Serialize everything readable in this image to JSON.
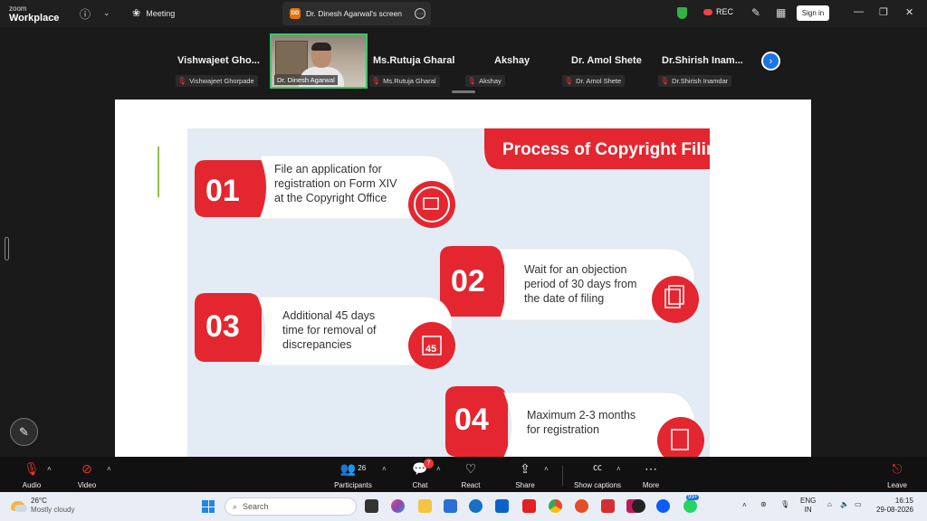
{
  "titlebar": {
    "brand_line1": "zoom",
    "brand_line2": "Workplace",
    "info_icon": "info-icon",
    "meeting_label": "Meeting",
    "screen_tab_badge": "DD",
    "screen_tab_title": "Dr. Dinesh Agarwal's screen",
    "rec_label": "REC",
    "signin_label": "Sign in"
  },
  "participants": [
    {
      "name": "Vishwajeet  Gho...",
      "label": "Vishwajeet Ghorpade"
    },
    {
      "name": "",
      "label": "Dr. Dinesh Agarwal"
    },
    {
      "name": "Ms.Rutuja Gharal",
      "label": "Ms.Rutuja Gharal"
    },
    {
      "name": "Akshay",
      "label": "Akshay"
    },
    {
      "name": "Dr. Amol Shete",
      "label": "Dr. Amol Shete"
    },
    {
      "name": "Dr.Shirish  Inam...",
      "label": "Dr.Shirish Inamdar"
    }
  ],
  "slide": {
    "banner": "Process of Copyright Filing",
    "steps": [
      {
        "num": "01",
        "lines": [
          "File an application for",
          "registration on Form XIV",
          "at the Copyright Office"
        ]
      },
      {
        "num": "02",
        "lines": [
          "Wait for an objection",
          "period of 30 days from",
          "the date of filing"
        ]
      },
      {
        "num": "03",
        "lines": [
          "Additional 45 days",
          "time for removal of",
          "discrepancies"
        ]
      },
      {
        "num": "04",
        "lines": [
          "Maximum 2-3 months",
          "for registration"
        ]
      }
    ],
    "calendar_number": "45"
  },
  "toolbar": {
    "audio": "Audio",
    "video": "Video",
    "participants": "Participants",
    "participants_count": "26",
    "chat": "Chat",
    "chat_badge": "7",
    "react": "React",
    "share": "Share",
    "captions": "Show captions",
    "more": "More",
    "leave": "Leave"
  },
  "taskbar": {
    "temperature": "26°C",
    "weather": "Mostly cloudy",
    "search_placeholder": "Search",
    "lang_line1": "ENG",
    "lang_line2": "IN",
    "time": "16:15",
    "date": "29-08-2026",
    "badge_99": "99+"
  },
  "colors": {
    "accent_red": "#e3262f",
    "zoom_blue": "#1a73e8",
    "active_speaker_green": "#3ec46d"
  }
}
